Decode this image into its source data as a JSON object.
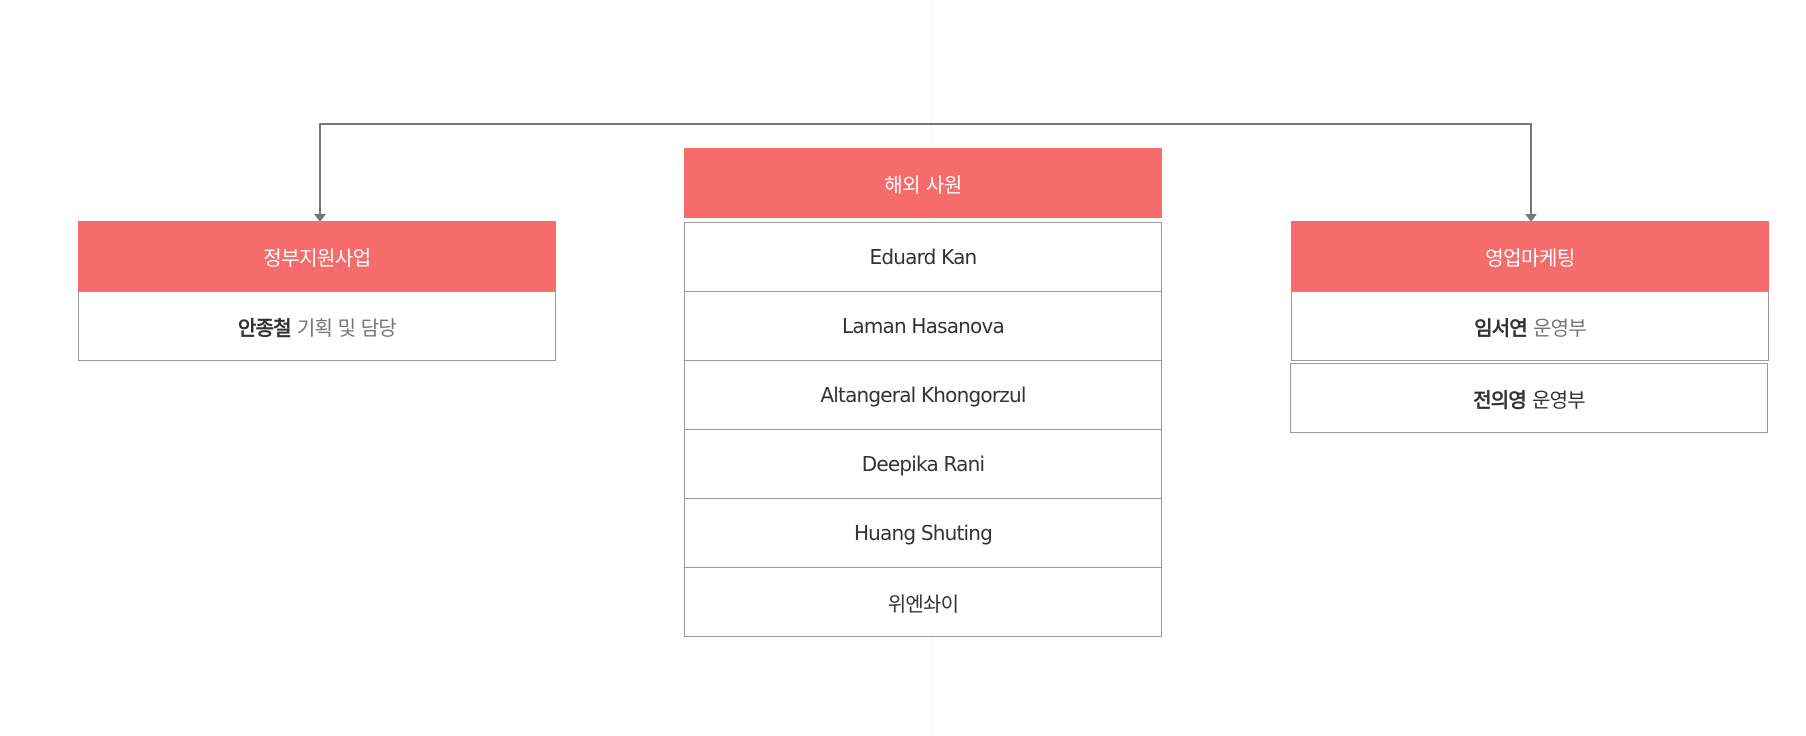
{
  "colors": {
    "header": "#f66b6b",
    "border": "#9a9a9a",
    "connector": "#777777"
  },
  "left_dept": {
    "title": "정부지원사업",
    "members": [
      {
        "name": "안종철",
        "role": "기획 및 담당"
      }
    ]
  },
  "center_dept": {
    "title": "해외 사원",
    "members": [
      "Eduard Kan",
      "Laman Hasanova",
      "Altangeral Khongorzul",
      "Deepika Rani",
      "Huang Shuting",
      "위엔솨이"
    ]
  },
  "right_dept": {
    "title": "영업마케팅",
    "members": [
      {
        "name": "임서연",
        "role": "운영부"
      },
      {
        "name": "전의영",
        "role": "운영부"
      }
    ]
  }
}
